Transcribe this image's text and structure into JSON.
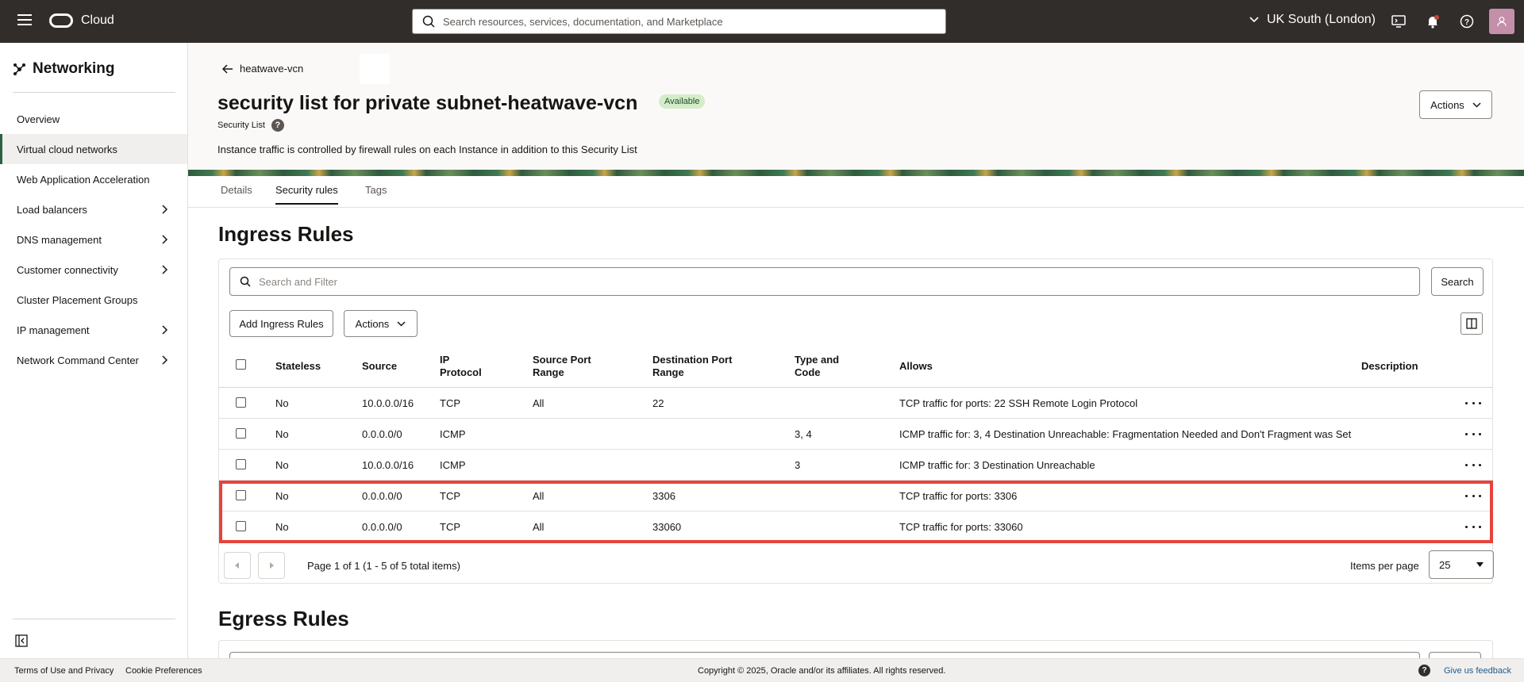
{
  "topbar": {
    "brand": "Cloud",
    "search_placeholder": "Search resources, services, documentation, and Marketplace",
    "region": "UK South (London)"
  },
  "sidebar": {
    "title": "Networking",
    "items": [
      {
        "label": "Overview",
        "has_submenu": false,
        "active": false
      },
      {
        "label": "Virtual cloud networks",
        "has_submenu": false,
        "active": true
      },
      {
        "label": "Web Application Acceleration",
        "has_submenu": false,
        "active": false
      },
      {
        "label": "Load balancers",
        "has_submenu": true,
        "active": false
      },
      {
        "label": "DNS management",
        "has_submenu": true,
        "active": false
      },
      {
        "label": "Customer connectivity",
        "has_submenu": true,
        "active": false
      },
      {
        "label": "Cluster Placement Groups",
        "has_submenu": false,
        "active": false
      },
      {
        "label": "IP management",
        "has_submenu": true,
        "active": false
      },
      {
        "label": "Network Command Center",
        "has_submenu": true,
        "active": false
      }
    ]
  },
  "header": {
    "back_label": "heatwave-vcn",
    "title": "security list for private subnet-heatwave-vcn",
    "status": "Available",
    "resource_type": "Security List",
    "description": "Instance traffic is controlled by firewall rules on each Instance in addition to this Security List",
    "actions_label": "Actions"
  },
  "tabs": [
    "Details",
    "Security rules",
    "Tags"
  ],
  "ingress": {
    "title": "Ingress Rules",
    "filter_placeholder": "Search and Filter",
    "search_button": "Search",
    "add_button": "Add Ingress Rules",
    "actions_button": "Actions",
    "columns": {
      "stateless": "Stateless",
      "source": "Source",
      "ip_protocol": "IP Protocol",
      "source_port_range": "Source Port Range",
      "destination_port_range": "Destination Port Range",
      "type_and_code": "Type and Code",
      "allows": "Allows",
      "description": "Description"
    },
    "rows": [
      {
        "stateless": "No",
        "source": "10.0.0.0/16",
        "protocol": "TCP",
        "src_port": "All",
        "dst_port": "22",
        "type_code": "",
        "allows": "TCP traffic for ports: 22 SSH Remote Login Protocol",
        "description": ""
      },
      {
        "stateless": "No",
        "source": "0.0.0.0/0",
        "protocol": "ICMP",
        "src_port": "",
        "dst_port": "",
        "type_code": "3, 4",
        "allows": "ICMP traffic for: 3, 4 Destination Unreachable: Fragmentation Needed and Don't Fragment was Set",
        "description": ""
      },
      {
        "stateless": "No",
        "source": "10.0.0.0/16",
        "protocol": "ICMP",
        "src_port": "",
        "dst_port": "",
        "type_code": "3",
        "allows": "ICMP traffic for: 3 Destination Unreachable",
        "description": ""
      },
      {
        "stateless": "No",
        "source": "0.0.0.0/0",
        "protocol": "TCP",
        "src_port": "All",
        "dst_port": "3306",
        "type_code": "",
        "allows": "TCP traffic for ports: 3306",
        "description": ""
      },
      {
        "stateless": "No",
        "source": "0.0.0.0/0",
        "protocol": "TCP",
        "src_port": "All",
        "dst_port": "33060",
        "type_code": "",
        "allows": "TCP traffic for ports: 33060",
        "description": ""
      }
    ],
    "pagination": "Page 1 of 1 (1 - 5 of 5 total items)",
    "items_per_page_label": "Items per page",
    "items_per_page": "25"
  },
  "egress": {
    "title": "Egress Rules"
  },
  "footer": {
    "terms": "Terms of Use and Privacy",
    "cookies": "Cookie Preferences",
    "copyright": "Copyright © 2025, Oracle and/or its affiliates. All rights reserved.",
    "feedback": "Give us feedback"
  }
}
